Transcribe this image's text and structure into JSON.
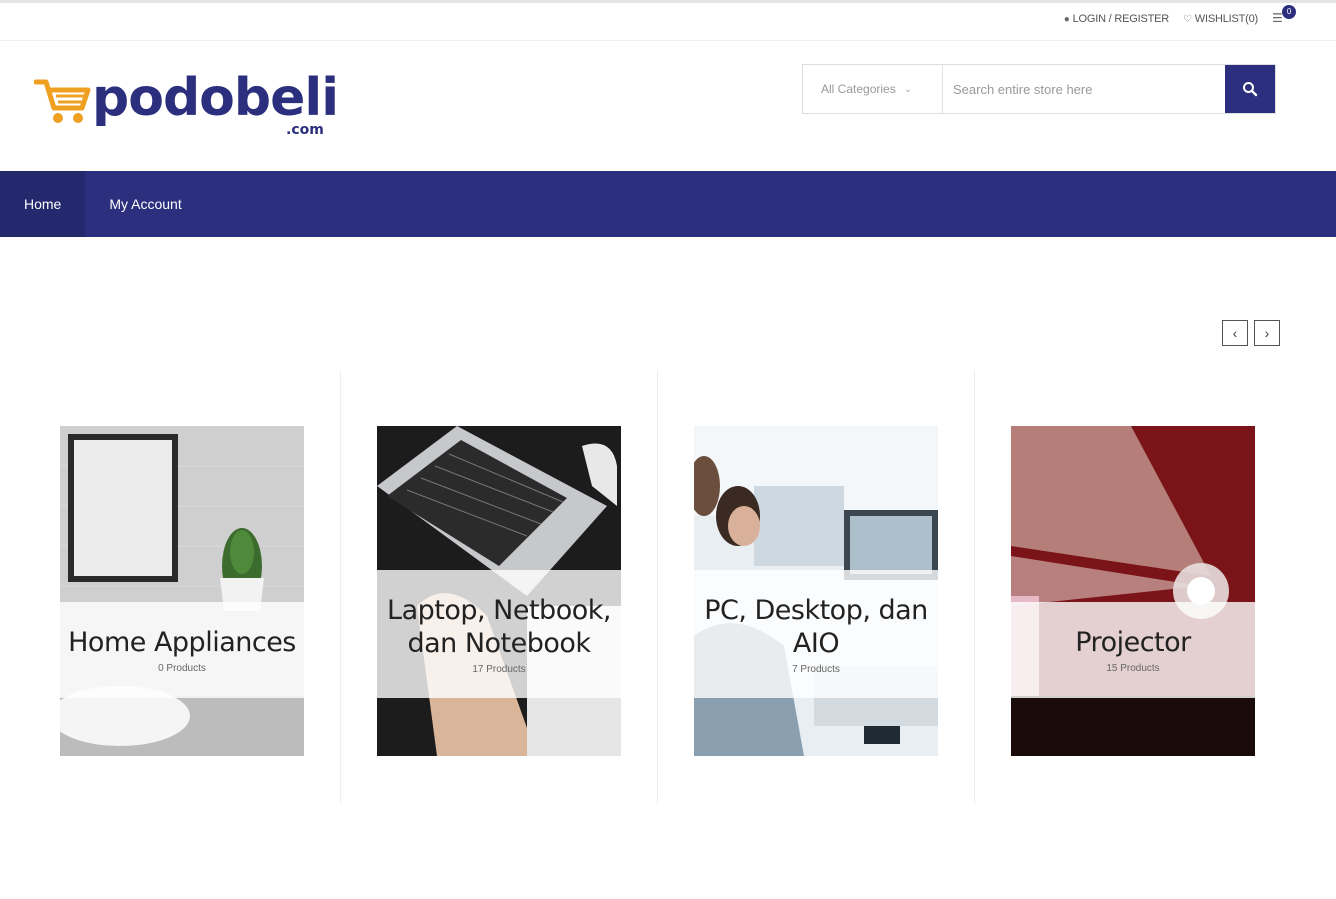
{
  "topbar": {
    "login_label": "LOGIN / REGISTER",
    "wishlist_label": "WISHLIST(0)",
    "cart_count": "0"
  },
  "logo": {
    "wordmark": "podobeli",
    "domain": ".com"
  },
  "search": {
    "category_label": "All Categories",
    "placeholder": "Search entire store here",
    "value": ""
  },
  "nav": {
    "items": [
      {
        "label": "Home",
        "active": true
      },
      {
        "label": "My Account",
        "active": false
      }
    ]
  },
  "slider": {
    "prev_label": "‹",
    "next_label": "›"
  },
  "categories": [
    {
      "title": "Home Appliances",
      "count": "0 Products"
    },
    {
      "title": "Laptop, Netbook, dan Notebook",
      "count": "17 Products"
    },
    {
      "title": "PC, Desktop, dan AIO",
      "count": "7 Products"
    },
    {
      "title": "Projector",
      "count": "15 Products"
    }
  ],
  "colors": {
    "brand": "#2b2f7d",
    "logo_cart": "#f0a020"
  }
}
